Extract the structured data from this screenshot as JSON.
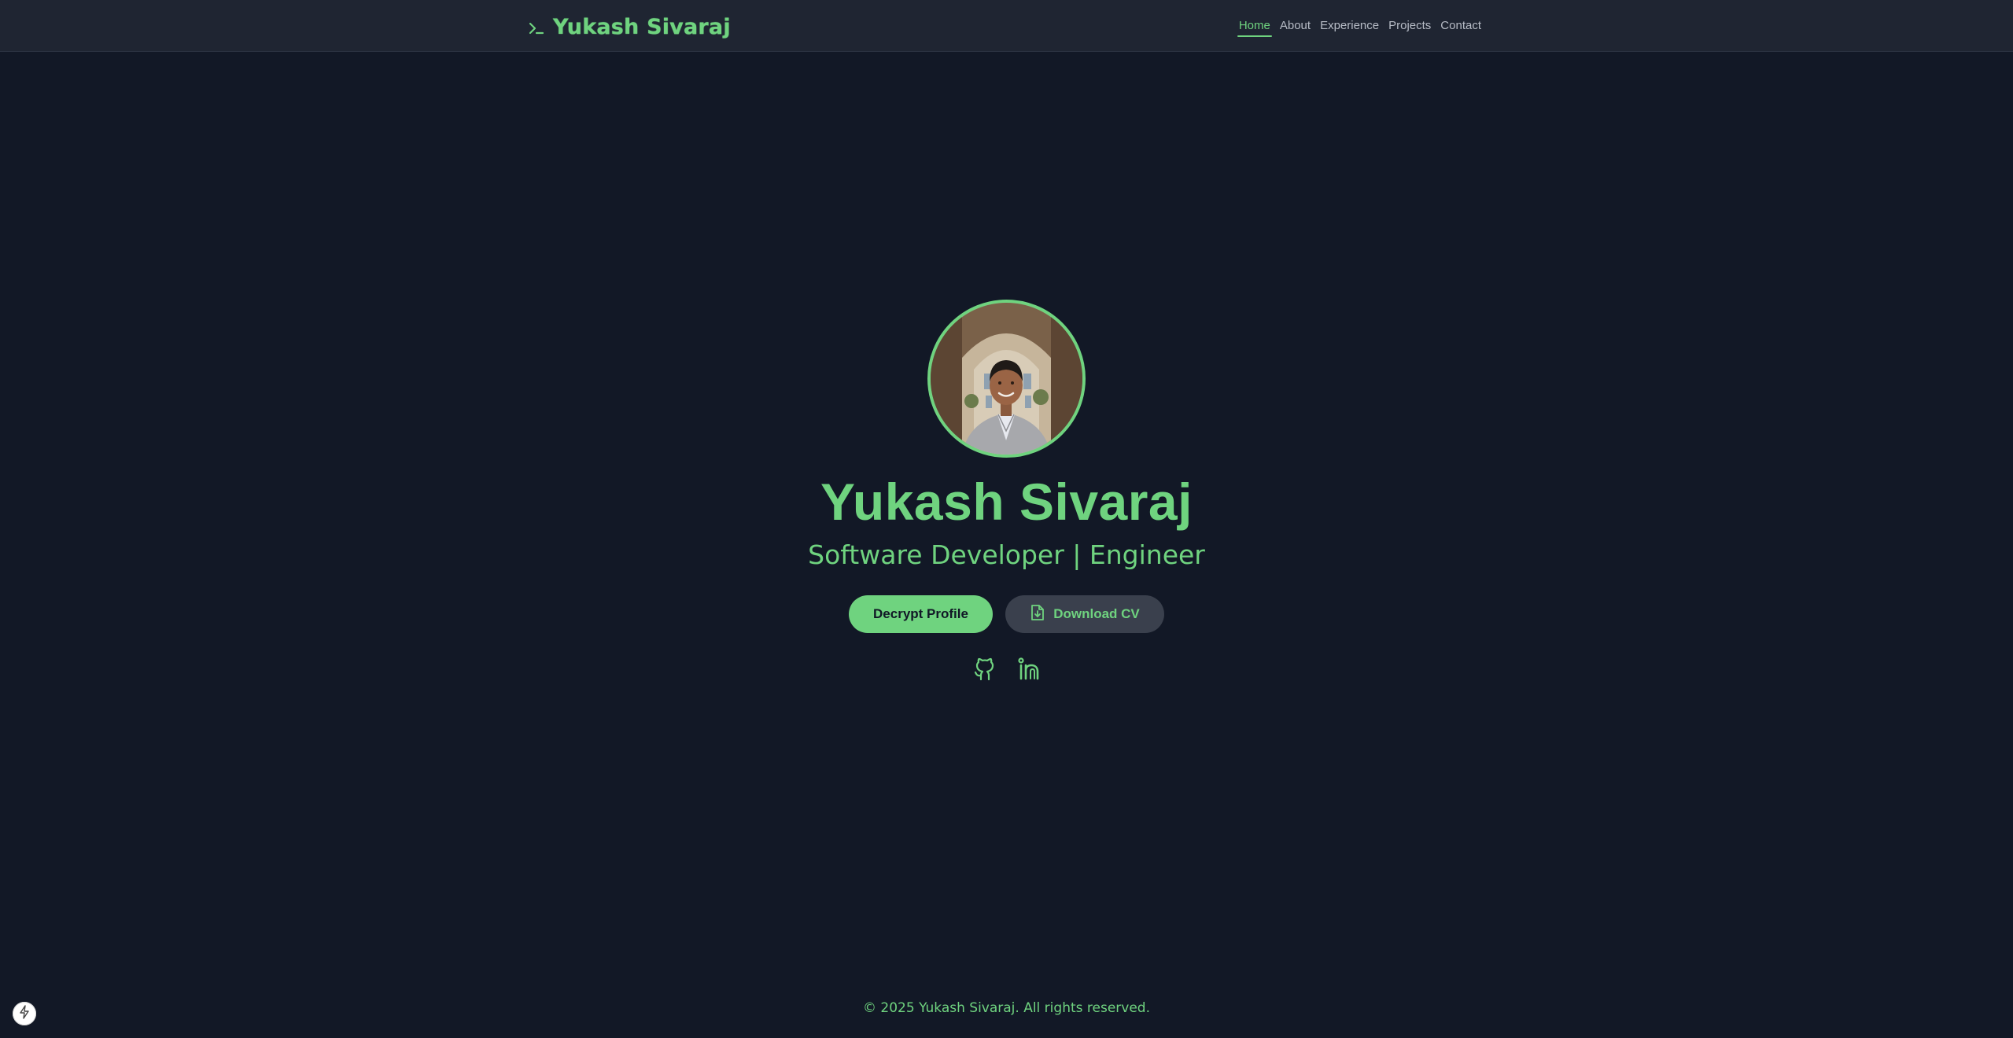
{
  "navbar": {
    "brand_text": "Yukash Sivaraj",
    "brand_icon": "terminal-prompt-icon",
    "items": [
      {
        "label": "Home",
        "active": true
      },
      {
        "label": "About",
        "active": false
      },
      {
        "label": "Experience",
        "active": false
      },
      {
        "label": "Projects",
        "active": false
      },
      {
        "label": "Contact",
        "active": false
      }
    ]
  },
  "hero": {
    "avatar": "profile-photo",
    "name": "Yukash Sivaraj",
    "tagline": "Software Developer | Engineer",
    "primary_button": "Decrypt Profile",
    "secondary_button": "Download CV",
    "secondary_button_icon": "file-download-icon",
    "socials": [
      {
        "icon": "github-icon"
      },
      {
        "icon": "linkedin-icon"
      }
    ]
  },
  "footer": {
    "copyright": "© 2025 Yukash Sivaraj. All rights reserved."
  },
  "corner_widget": {
    "icon": "lightning-bolt-icon"
  },
  "colors": {
    "background": "#121826",
    "navbar": "#1f2532",
    "accent": "#6fd37f",
    "secondary_button": "#3a404d",
    "nav_text": "#b7bcc6"
  }
}
